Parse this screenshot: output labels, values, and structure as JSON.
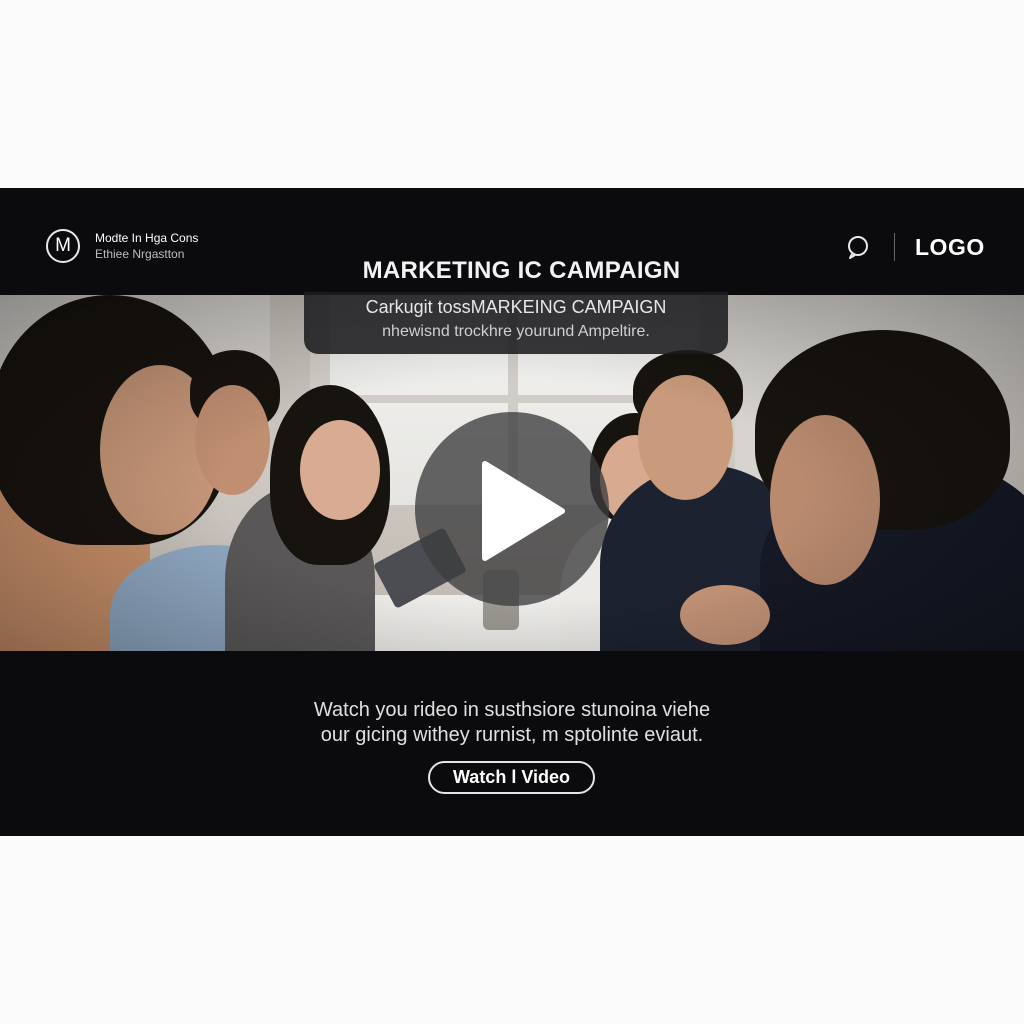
{
  "brand": {
    "mark": "M",
    "name": "Modte In Hga Cons",
    "subtitle": "Ethiee Nrgastton"
  },
  "header": {
    "search_icon": "search-icon",
    "logo": "LOGO"
  },
  "hero": {
    "title": "MARKETING IC CAMPAIGN",
    "card_line1": "Carkugit tossMARKEING CAMPAIGN",
    "card_line2": "nhewisnd trockhre yourund Ampeltire.",
    "play_icon": "play-icon",
    "description_line1": "Watch you rideo in susthsiore stunoina viehe",
    "description_line2": "our gicing withey rurnist, m sptolinte eviaut.",
    "cta_label": "Watch l Video"
  },
  "colors": {
    "banner_background": "#0b0b0d",
    "page_background": "#fbfbfb",
    "text_primary": "#ffffff"
  }
}
